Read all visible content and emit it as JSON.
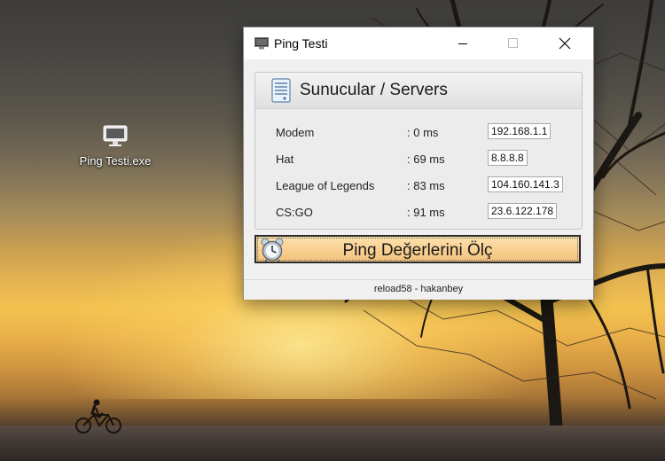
{
  "desktop": {
    "icon": {
      "label": "Ping Testi.exe",
      "icon": "network-monitor-icon"
    }
  },
  "window": {
    "title": "Ping Testi",
    "app_icon": "monitor-icon",
    "controls": {
      "minimize": "minimize-icon",
      "maximize": "maximize-icon",
      "close": "close-icon"
    },
    "panel": {
      "heading": "Sunucular / Servers",
      "icon": "server-icon",
      "rows": [
        {
          "name": "Modem",
          "ping": ": 0 ms",
          "ip": "192.168.1.1"
        },
        {
          "name": "Hat",
          "ping": ": 69 ms",
          "ip": "8.8.8.8"
        },
        {
          "name": "League of Legends",
          "ping": ": 83 ms",
          "ip": "104.160.141.3"
        },
        {
          "name": "CS:GO",
          "ping": ": 91 ms",
          "ip": "23.6.122.178"
        }
      ]
    },
    "ping_button": {
      "label": "Ping Değerlerini Ölç",
      "icon": "alarm-clock-icon",
      "color": "#f9d193"
    },
    "footer": {
      "credit": "reload58 - hakanbey"
    }
  }
}
